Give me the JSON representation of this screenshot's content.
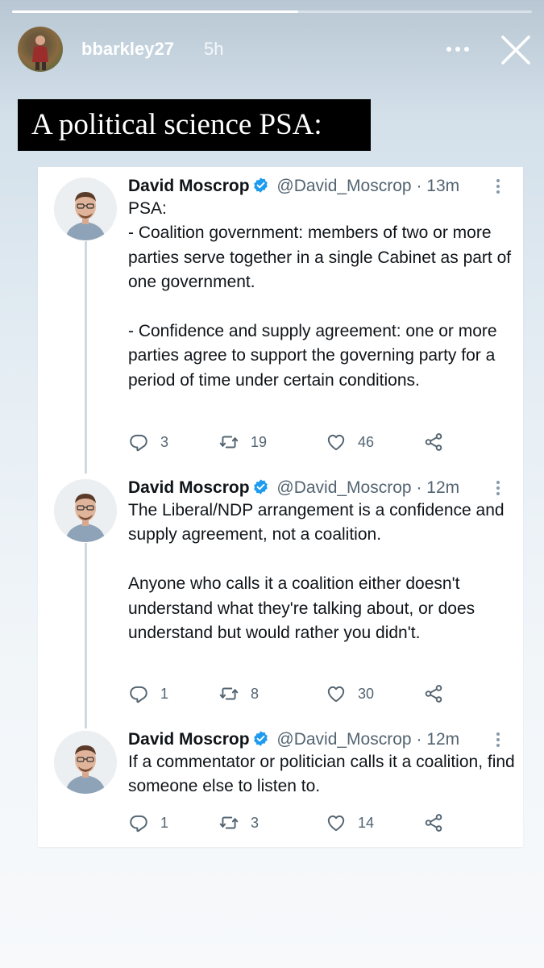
{
  "story": {
    "username": "bbarkley27",
    "time": "5h",
    "progress": 0.55
  },
  "title_banner": "A political science PSA:",
  "tweets": [
    {
      "name": "David Moscrop",
      "handle": "@David_Moscrop",
      "separator": "·",
      "time": "13m",
      "text": "PSA:\n- Coalition government: members of two or more parties serve together in a single Cabinet as part of one government.\n\n- Confidence and supply agreement: one or more parties agree to support the governing party for a period of time under certain conditions.",
      "replies": "3",
      "retweets": "19",
      "likes": "46"
    },
    {
      "name": "David Moscrop",
      "handle": "@David_Moscrop",
      "separator": "·",
      "time": "12m",
      "text": "The Liberal/NDP arrangement is a confidence and supply agreement, not a coalition.\n\nAnyone who calls it a coalition either doesn't understand what they're talking about, or does understand but would rather you didn't.",
      "replies": "1",
      "retweets": "8",
      "likes": "30"
    },
    {
      "name": "David Moscrop",
      "handle": "@David_Moscrop",
      "separator": "·",
      "time": "12m",
      "text": "If a commentator or politician calls it a coalition, find someone else to listen to.",
      "replies": "1",
      "retweets": "3",
      "likes": "14"
    }
  ],
  "icons": {
    "story_more": "more-horizontal-icon",
    "story_close": "close-icon",
    "verified": "verified-badge-icon",
    "tweet_more": "more-vertical-icon",
    "reply": "reply-icon",
    "retweet": "retweet-icon",
    "like": "heart-icon",
    "share": "share-icon"
  },
  "colors": {
    "verified": "#1d9bf0",
    "text_primary": "#0f1419",
    "text_secondary": "#536471",
    "thread_line": "#cfd9de"
  }
}
